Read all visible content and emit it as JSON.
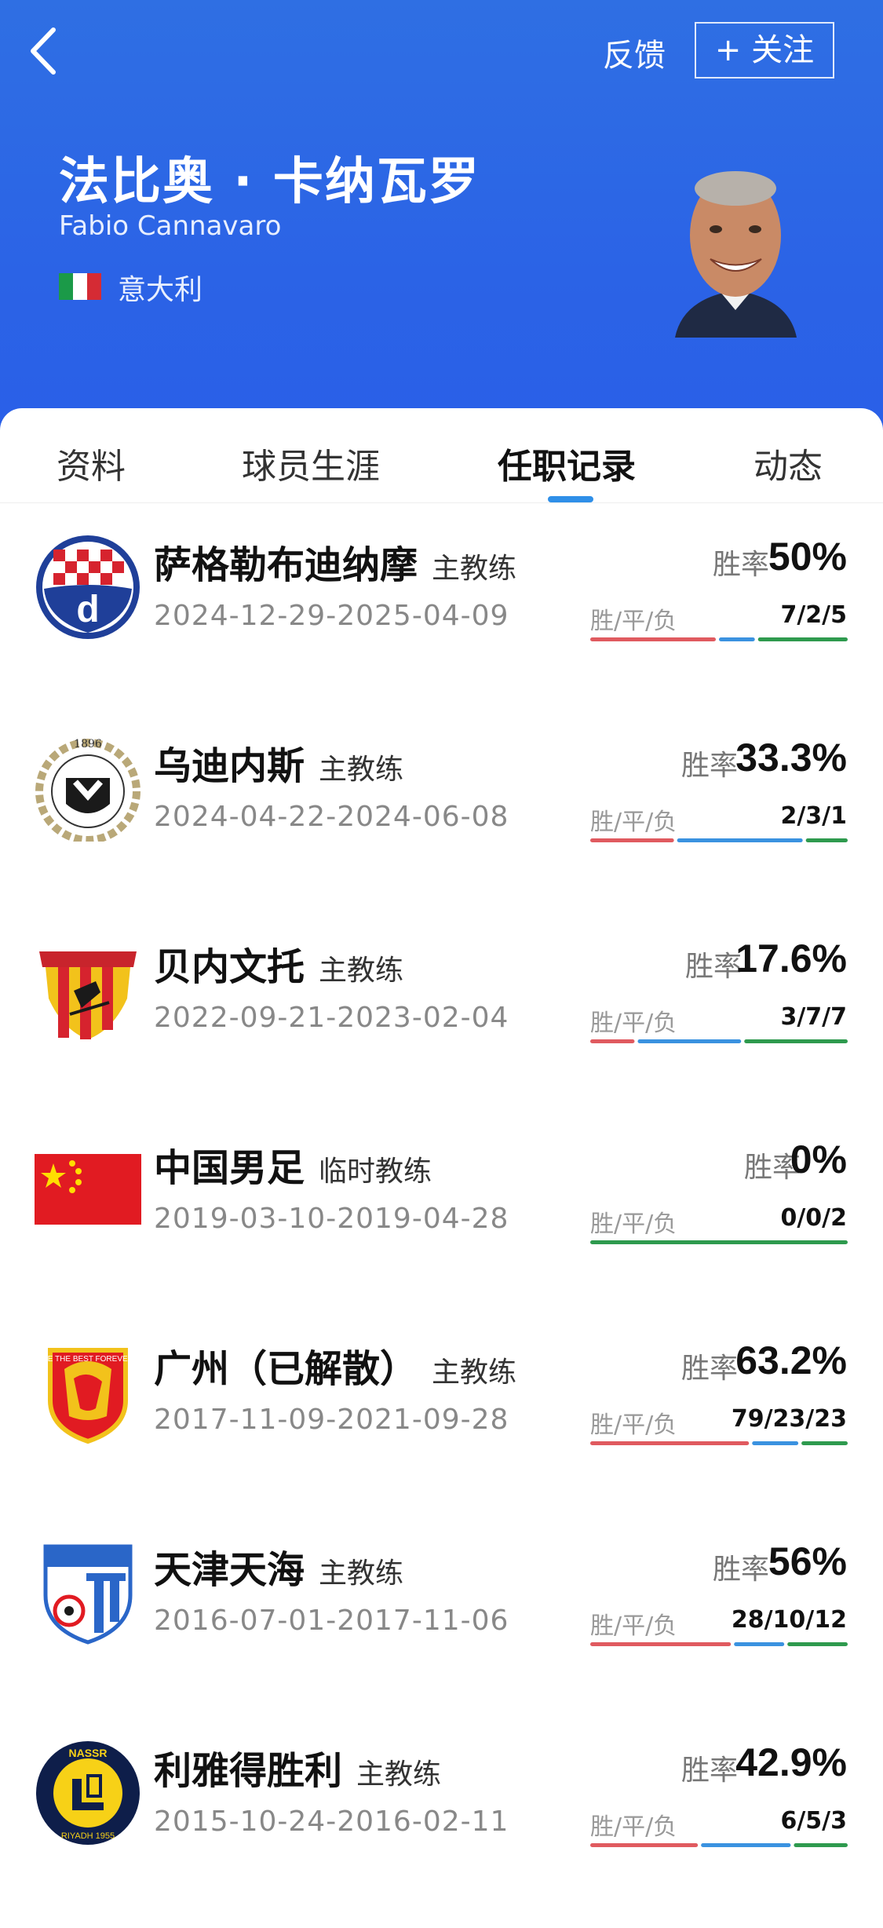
{
  "header": {
    "feedback_label": "反馈",
    "follow_label": "+ 关注",
    "name_zh": "法比奥 · 卡纳瓦罗",
    "name_en": "Fabio Cannavaro",
    "nationality": "意大利"
  },
  "tabs": [
    {
      "label": "资料"
    },
    {
      "label": "球员生涯"
    },
    {
      "label": "任职记录",
      "active": true
    },
    {
      "label": "动态"
    }
  ],
  "stats_labels": {
    "rate": "胜率",
    "wdl": "胜/平/负"
  },
  "colors": {
    "win": "#e05a5f",
    "draw": "#3a92e0",
    "loss": "#2e9a4e",
    "header": "#2b63e6"
  },
  "records": [
    {
      "club": "萨格勒布迪纳摩",
      "role": "主教练",
      "dates": "2024-12-29-2025-04-09",
      "rate": "50%",
      "wdl": "7/2/5",
      "w": 7,
      "d": 2,
      "l": 5,
      "logo": "dinamo-zagreb-logo-icon"
    },
    {
      "club": "乌迪内斯",
      "role": "主教练",
      "dates": "2024-04-22-2024-06-08",
      "rate": "33.3%",
      "wdl": "2/3/1",
      "w": 2,
      "d": 3,
      "l": 1,
      "logo": "udinese-logo-icon"
    },
    {
      "club": "贝内文托",
      "role": "主教练",
      "dates": "2022-09-21-2023-02-04",
      "rate": "17.6%",
      "wdl": "3/7/7",
      "w": 3,
      "d": 7,
      "l": 7,
      "logo": "benevento-logo-icon"
    },
    {
      "club": "中国男足",
      "role": "临时教练",
      "dates": "2019-03-10-2019-04-28",
      "rate": "0%",
      "wdl": "0/0/2",
      "w": 0,
      "d": 0,
      "l": 2,
      "logo": "china-flag-icon"
    },
    {
      "club": "广州（已解散）",
      "role": "主教练",
      "dates": "2017-11-09-2021-09-28",
      "rate": "63.2%",
      "wdl": "79/23/23",
      "w": 79,
      "d": 23,
      "l": 23,
      "logo": "guangzhou-logo-icon"
    },
    {
      "club": "天津天海",
      "role": "主教练",
      "dates": "2016-07-01-2017-11-06",
      "rate": "56%",
      "wdl": "28/10/12",
      "w": 28,
      "d": 10,
      "l": 12,
      "logo": "tianjin-tianhai-logo-icon"
    },
    {
      "club": "利雅得胜利",
      "role": "主教练",
      "dates": "2015-10-24-2016-02-11",
      "rate": "42.9%",
      "wdl": "6/5/3",
      "w": 6,
      "d": 5,
      "l": 3,
      "logo": "al-nassr-logo-icon"
    }
  ]
}
